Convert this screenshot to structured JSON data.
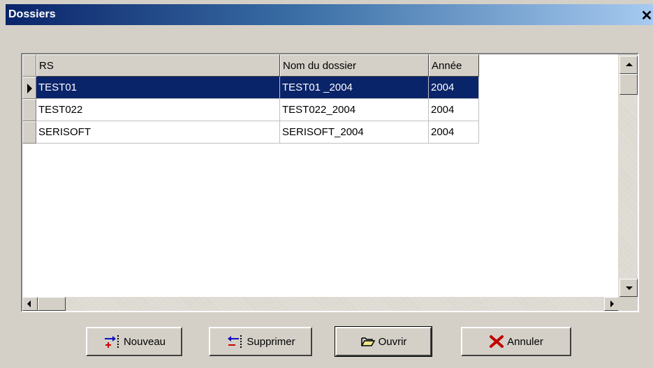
{
  "window": {
    "title": "Dossiers",
    "close_glyph": "✕"
  },
  "grid": {
    "columns": [
      "RS",
      "Nom du dossier",
      "Année"
    ],
    "rows": [
      {
        "rs": "TEST01",
        "nom": "TEST01 _2004",
        "annee": "2004",
        "selected": true
      },
      {
        "rs": "TEST022",
        "nom": "TEST022_2004",
        "annee": "2004",
        "selected": false
      },
      {
        "rs": "SERISOFT",
        "nom": "SERISOFT_2004",
        "annee": "2004",
        "selected": false
      }
    ]
  },
  "buttons": {
    "nouveau": {
      "label": "Nouveau",
      "icon": "add-record-icon"
    },
    "supprimer": {
      "label": "Supprimer",
      "icon": "delete-record-icon"
    },
    "ouvrir": {
      "label": "Ouvrir",
      "icon": "open-folder-icon"
    },
    "annuler": {
      "label": "Annuler",
      "icon": "red-x-icon"
    }
  },
  "colors": {
    "selection": "#0a246a",
    "titlebar_start": "#0a246a",
    "titlebar_end": "#a6caf0",
    "face": "#d4d0c8"
  }
}
